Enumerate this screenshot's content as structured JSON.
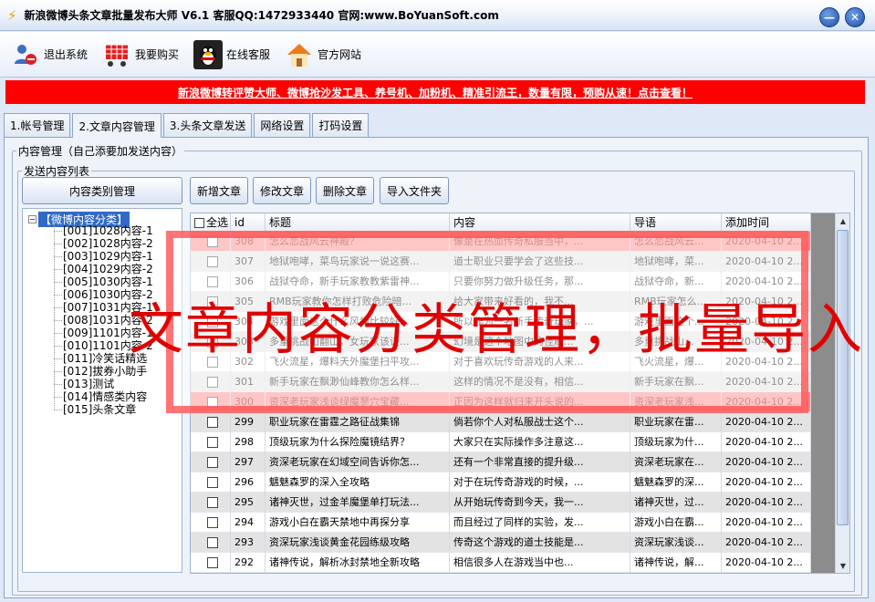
{
  "window": {
    "title": "新浪微博头条文章批量发布大师 V6.1 客服QQ:1472933440 官网:www.BoYuanSoft.com"
  },
  "toolbar": [
    {
      "label": "退出系统",
      "icon": "users-logout-icon"
    },
    {
      "label": "我要购买",
      "icon": "shopping-cart-icon"
    },
    {
      "label": "在线客服",
      "icon": "qq-penguin-icon"
    },
    {
      "label": "官方网站",
      "icon": "home-icon"
    }
  ],
  "banner": {
    "text": "新浪微博转评赞大师、微博抢沙发工具、养号机、加粉机、精准引流王，数量有限，预购从速！点击查看！"
  },
  "tabs": [
    "1.帐号管理",
    "2.文章内容管理",
    "3.头条文章发送",
    "网络设置",
    "打码设置"
  ],
  "content_group": {
    "legend": "内容管理（自己添要加发送内容）"
  },
  "list_group": {
    "legend": "发送内容列表"
  },
  "buttons": {
    "category": "内容类别管理",
    "add": "新增文章",
    "edit": "修改文章",
    "delete": "删除文章",
    "import": "导入文件夹"
  },
  "tree": {
    "root": "【微博内容分类】",
    "nodes": [
      "[001]1028内容-1",
      "[002]1028内容-2",
      "[003]1029内容-1",
      "[004]1029内容-2",
      "[005]1030内容-1",
      "[006]1030内容-2",
      "[007]1031内容-1",
      "[008]1031内容-2",
      "[009]1101内容-1",
      "[010]1101内容-2",
      "[011]冷笑话精选",
      "[012]拔券小助手",
      "[013]测试",
      "[014]情感类内容",
      "[015]头条文章"
    ]
  },
  "grid": {
    "columns": [
      "全选",
      "id",
      "标题",
      "内容",
      "导语",
      "添加时间"
    ],
    "rows": [
      {
        "id": "308",
        "title": "怎么恋战风云神殿？",
        "content": "像是在热血传奇私服当中，...",
        "lead": "怎么恋战风云...",
        "time": "2020-04-10 2..."
      },
      {
        "id": "307",
        "title": "地狱咆哮，菜鸟玩家说一说这赛...",
        "content": "道士职业只要学会了这些技...",
        "lead": "地狱咆哮，菜...",
        "time": "2020-04-10 2..."
      },
      {
        "id": "306",
        "title": "战狱夺命，新手玩家教教紫雷神...",
        "content": "只要你努力做升级任务，那...",
        "lead": "战狱夺命，新...",
        "time": "2020-04-10 2..."
      },
      {
        "id": "305",
        "title": "RMB玩家教你怎样打败危险暗...",
        "content": "给大家带来好看的，我不...",
        "lead": "RMB玩家怎么...",
        "time": "2020-04-10 2..."
      },
      {
        "id": "304",
        "title": "游戏里面这个什么风翎比较好...",
        "content": "所以作为一名新手传奇玩家，...",
        "lead": "游戏里面这个...",
        "time": "2020-04-10 2..."
      },
      {
        "id": "303",
        "title": "多重挑战山翻山，女玩家该谈...",
        "content": "幻境是这个地图中的怪刷...",
        "lead": "多重挑战山...",
        "time": "2020-04-10 2..."
      },
      {
        "id": "302",
        "title": "飞火流星，爆料天外魔堡扫平攻...",
        "content": "对于喜欢玩传奇游戏的人来...",
        "lead": "飞火流星，爆...",
        "time": "2020-04-10 2..."
      },
      {
        "id": "301",
        "title": "新手玩家在飘渺仙峰教你怎么样...",
        "content": "这样的情况不是没有，相信...",
        "lead": "新手玩家在飘...",
        "time": "2020-04-10 2..."
      },
      {
        "id": "300",
        "title": "资深老玩家浅谈绿魔蓼穴宝藏...",
        "content": "正因为这样就归来开头说的...",
        "lead": "资深老玩家浅...",
        "time": "2020-04-10 2..."
      },
      {
        "id": "299",
        "title": "职业玩家在雷霆之路征战集锦",
        "content": "倘若你个人对私服战士这个...",
        "lead": "职业玩家在雷...",
        "time": "2020-04-10 2..."
      },
      {
        "id": "298",
        "title": "顶级玩家为什么探险魔镜结界？",
        "content": "大家只在实际操作多注意这...",
        "lead": "顶级玩家为什...",
        "time": "2020-04-10 2..."
      },
      {
        "id": "297",
        "title": "资深老玩家在幻域空间告诉你怎...",
        "content": "还有一个非常直接的提升级...",
        "lead": "资深老玩家在...",
        "time": "2020-04-10 2..."
      },
      {
        "id": "296",
        "title": "魑魅森罗的深入全攻略",
        "content": "对于在玩传奇游戏的时候，...",
        "lead": "魑魅森罗的深...",
        "time": "2020-04-10 2..."
      },
      {
        "id": "295",
        "title": "诸神灭世，过金羊魔堡单打玩法...",
        "content": "从开始玩传奇到今天，我一...",
        "lead": "诸神灭世，过...",
        "time": "2020-04-10 2..."
      },
      {
        "id": "294",
        "title": "游戏小白在霸天禁地中再探分享",
        "content": "而且经过了同样的实验，发...",
        "lead": "游戏小白在霸...",
        "time": "2020-04-10 2..."
      },
      {
        "id": "293",
        "title": "资深玩家浅谈黄金花园练级攻略",
        "content": "传奇这个游戏的道士技能是...",
        "lead": "资深玩家浅谈...",
        "time": "2020-04-10 2..."
      },
      {
        "id": "292",
        "title": "诸神传说，解析冰封禁地全新攻略",
        "content": "相信很多人在游戏当中也...",
        "lead": "诸神传说，解...",
        "time": "2020-04-10 2..."
      }
    ]
  },
  "overlay": {
    "text": "文章内容分类管理，批量导入"
  }
}
